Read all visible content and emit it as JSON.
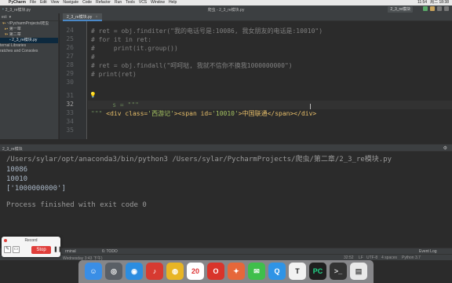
{
  "menubar": {
    "apple_glyph": "",
    "items": [
      "PyCharm",
      "File",
      "Edit",
      "View",
      "Navigate",
      "Code",
      "Refactor",
      "Run",
      "Tools",
      "VCS",
      "Window",
      "Help"
    ],
    "window_title": "爬虫 - 2_3_re模块.py",
    "clock": "11:54",
    "right_status": "周二 18:38"
  },
  "titlebar": {
    "file_crumb": "2_3_re模块.py",
    "run_config": "2_3_re模块"
  },
  "project_panel": {
    "header": "ect",
    "items": [
      {
        "label": "~/PycharmProjects/爬虫",
        "kind": "folder",
        "selected": false
      },
      {
        "label": "第一章",
        "kind": "folder",
        "selected": false
      },
      {
        "label": "第二章",
        "kind": "folder",
        "selected": false
      },
      {
        "label": "2_3_re模块.py",
        "kind": "pyfile",
        "selected": true
      },
      {
        "label": "ternal Libraries",
        "kind": "folder",
        "selected": false
      },
      {
        "label": "ratches and Consoles",
        "kind": "folder",
        "selected": false
      }
    ]
  },
  "editor": {
    "tab_label": "2_3_re模块.py",
    "line_numbers": [
      "24",
      "25",
      "26",
      "27",
      "28",
      "29",
      "30",
      "31",
      "32",
      "33",
      "34",
      "35"
    ],
    "current_line": "32",
    "lines": {
      "l24": "# ret = obj.finditer(\"我的电话号是:10086, 我女朋友的电话是:10010\")",
      "l25": "# for it in ret:",
      "l26": "#     print(it.group())",
      "l27": "#",
      "l28": "# ret = obj.findall(\"呵呵哒, 我就不信你不换我1000000000\")",
      "l29": "# print(ret)",
      "l31": "s = \"\"\"",
      "l32_a": "<div class=",
      "l32_b": "'西游记'",
      "l32_c": "><span id=",
      "l32_d": "'10010'",
      "l32_e": ">中国联通</span></div>",
      "l33": "\"\"\""
    }
  },
  "run_panel": {
    "header_label": "2_3_re模块",
    "command": "/Users/sylar/opt/anaconda3/bin/python3 /Users/sylar/PycharmProjects/爬虫/第二章/2_3_re模块.py",
    "output": [
      "10086",
      "10010",
      "['1000000000']"
    ],
    "exit_message": "Process finished with exit code 0"
  },
  "bottom_toolwindows": {
    "todo": "6: TODO",
    "terminal": "rminal",
    "event_log": "Event Log"
  },
  "statusbar": {
    "left_text": "Wednesday 3:43 下午)",
    "position": "32:52",
    "line_sep": "LF",
    "encoding": "UTF-8",
    "indent": "4 spaces",
    "interpreter": "Python 3.7"
  },
  "recorder": {
    "title": "Record",
    "stop_label": "Stop",
    "pause_glyph": "❚❚"
  },
  "dock": {
    "apps": [
      {
        "name": "finder",
        "glyph": "☺",
        "color": "#3a8ee6"
      },
      {
        "name": "launchpad",
        "glyph": "◎",
        "color": "#5a5f66"
      },
      {
        "name": "safari",
        "glyph": "◉",
        "color": "#2c8de0"
      },
      {
        "name": "netease-music",
        "glyph": "♪",
        "color": "#d73a31"
      },
      {
        "name": "chrome",
        "glyph": "◍",
        "color": "#e8b524"
      },
      {
        "name": "calendar",
        "glyph": "20",
        "color": "#ffffff"
      },
      {
        "name": "opera",
        "glyph": "O",
        "color": "#d9342b"
      },
      {
        "name": "firefox",
        "glyph": "✦",
        "color": "#e6673a"
      },
      {
        "name": "wechat",
        "glyph": "✉",
        "color": "#3fbf4b"
      },
      {
        "name": "qq",
        "glyph": "Q",
        "color": "#2f94e6"
      },
      {
        "name": "typora",
        "glyph": "T",
        "color": "#f2f2f2"
      },
      {
        "name": "pycharm",
        "glyph": "PC",
        "color": "#1f1f1f"
      },
      {
        "name": "terminal",
        "glyph": ">_",
        "color": "#333333"
      },
      {
        "name": "notes",
        "glyph": "▤",
        "color": "#e9e9e9"
      }
    ]
  },
  "colors": {
    "editor_bg": "#2b2b2b",
    "comment": "#808080",
    "string": "#6a8759",
    "tag": "#e8bf6a",
    "recorder_stop": "#e03e3a"
  }
}
